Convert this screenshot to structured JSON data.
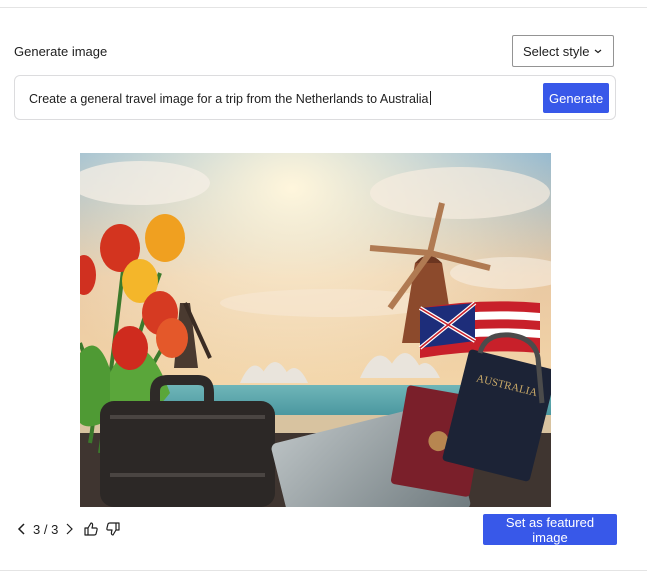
{
  "generator": {
    "section_label": "Generate image",
    "style_select": {
      "selected": "Select style"
    },
    "prompt": {
      "value": "Create a general travel image for a trip from the Netherlands to Australia"
    },
    "generate_label": "Generate"
  },
  "image_pager": {
    "current": "3",
    "separator": " / ",
    "total": "3"
  },
  "passport_text": "AUSTRALIA",
  "featured_label": "Set as featured image",
  "colors": {
    "accent": "#3858e9",
    "border": "#dcdcde",
    "text": "#1e1e1e"
  }
}
